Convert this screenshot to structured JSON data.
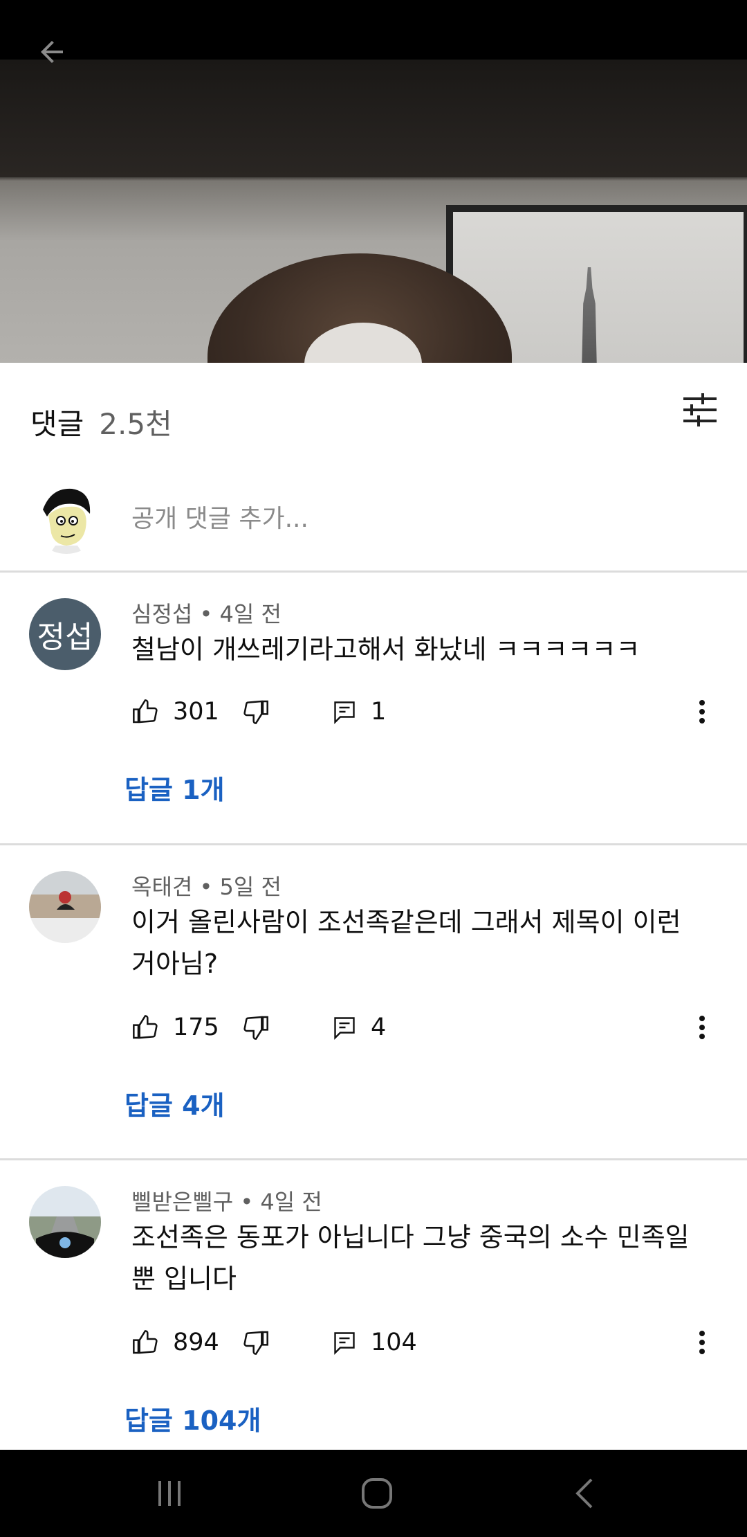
{
  "header": {
    "title": "댓글",
    "count": "2.5천"
  },
  "add_comment": {
    "placeholder": "공개 댓글 추가..."
  },
  "comments": [
    {
      "author": "심정섭",
      "time": "4일 전",
      "avatar_text": "정섭",
      "text": "철남이 개쓰레기라고해서 화났네 ㅋㅋㅋㅋㅋㅋ",
      "likes": "301",
      "replies": "1",
      "replies_link": "답글 1개"
    },
    {
      "author": "옥태견",
      "time": "5일 전",
      "text": "이거 올린사람이 조선족같은데 그래서 제목이 이런거아님?",
      "likes": "175",
      "replies": "4",
      "replies_link": "답글 4개"
    },
    {
      "author": "삘받은삘구",
      "time": "4일 전",
      "text": "조선족은 동포가 아닙니다 그냥 중국의 소수 민족일뿐 입니다",
      "likes": "894",
      "replies": "104",
      "replies_link": "답글 104개"
    }
  ],
  "icons": {
    "back": "back-arrow-icon",
    "filter": "filter-icon",
    "like": "thumbs-up-icon",
    "dislike": "thumbs-down-icon",
    "reply": "reply-icon",
    "more": "more-vert-icon"
  },
  "colors": {
    "link": "#1a61c2",
    "avatar_bg": "#4b5d6b"
  }
}
